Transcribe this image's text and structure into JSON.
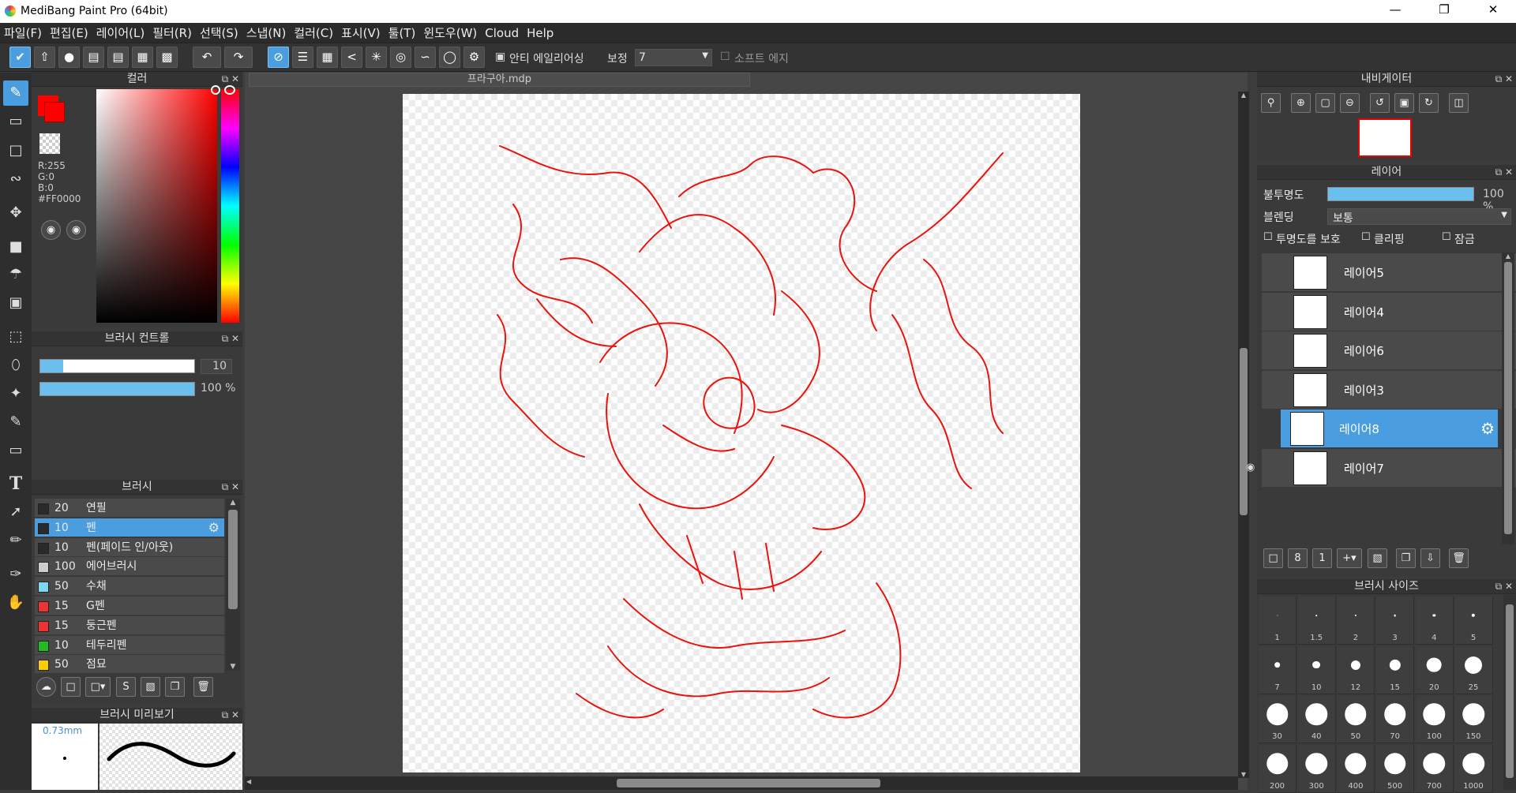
{
  "app": {
    "title": "MediBang Paint Pro (64bit)"
  },
  "menu": [
    "파일(F)",
    "편집(E)",
    "레이어(L)",
    "필터(R)",
    "선택(S)",
    "스냅(N)",
    "컬러(C)",
    "표시(V)",
    "툴(T)",
    "윈도우(W)",
    "Cloud",
    "Help"
  ],
  "toolbar": {
    "antialias_label": "안티 에일리어싱",
    "correction_label": "보정",
    "correction_value": "7",
    "soft_edge_label": "소프트 에지"
  },
  "document": {
    "tab": "프라구아.mdp"
  },
  "color_panel": {
    "title": "컬러",
    "r": "R:255",
    "g": "G:0",
    "b": "B:0",
    "hex": "#FF0000",
    "main_color": "#ff0000"
  },
  "brush_control": {
    "title": "브러시 컨트롤",
    "size": "10",
    "opacity": "100 %",
    "size_fraction": 0.15,
    "opacity_fraction": 1.0
  },
  "brush_panel": {
    "title": "브러시",
    "items": [
      {
        "size": "20",
        "name": "연필",
        "color": "#2a2a2a"
      },
      {
        "size": "10",
        "name": "펜",
        "color": "#2a2a2a"
      },
      {
        "size": "10",
        "name": "펜(페이드 인/아웃)",
        "color": "#2a2a2a"
      },
      {
        "size": "100",
        "name": "에어브러시",
        "color": "#cccccc"
      },
      {
        "size": "50",
        "name": "수채",
        "color": "#7fd8f0"
      },
      {
        "size": "15",
        "name": "G펜",
        "color": "#ee3333"
      },
      {
        "size": "15",
        "name": "둥근펜",
        "color": "#ee3333"
      },
      {
        "size": "10",
        "name": "테두리펜",
        "color": "#22bb22"
      },
      {
        "size": "50",
        "name": "점묘",
        "color": "#ffcc00"
      }
    ]
  },
  "brush_preview": {
    "title": "브러시 미리보기",
    "size": "0.73mm"
  },
  "navigator": {
    "title": "내비게이터"
  },
  "layer_panel": {
    "title": "레이어",
    "opacity_label": "불투명도",
    "opacity_value": "100 %",
    "opacity_fraction": 1.0,
    "blend_label": "블렌딩",
    "blend_value": "보통",
    "protect_label": "투명도를 보호",
    "clip_label": "클리핑",
    "lock_label": "잠금",
    "layers": [
      "레이어5",
      "레이어4",
      "레이어6",
      "레이어3",
      "레이어8",
      "레이어7"
    ]
  },
  "brush_size_panel": {
    "title": "브러시 사이즈",
    "sizes": [
      "1",
      "1.5",
      "2",
      "3",
      "4",
      "5",
      "7",
      "10",
      "12",
      "15",
      "20",
      "25",
      "30",
      "40",
      "50",
      "70",
      "100",
      "150",
      "200",
      "300",
      "400",
      "500",
      "700",
      "1000"
    ]
  }
}
